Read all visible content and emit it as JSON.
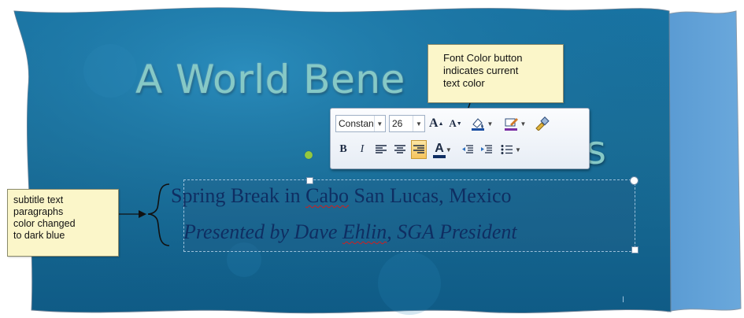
{
  "slide": {
    "title_line1": "A World Bene",
    "title_tail": "s",
    "subtitle_line1_a": "Spring Break in ",
    "subtitle_line1_b": "Cabo",
    "subtitle_line1_c": " San Lucas, Mexico",
    "subtitle_line2_a": "Presented by Dave ",
    "subtitle_line2_b": "Ehlin",
    "subtitle_line2_c": ", SGA President",
    "title_color": "#86c9c6",
    "subtitle_color": "#0f2e62",
    "background_color": "#1e6f9c"
  },
  "mini_toolbar": {
    "font_name": "Constan",
    "font_size": "26",
    "grow_font": "A",
    "shrink_font": "A",
    "bold": "B",
    "italic": "I",
    "font_color_letter": "A",
    "font_color_value": "#0f2e62",
    "icons": [
      "grow-font-icon",
      "shrink-font-icon",
      "highlight-fill-icon",
      "shape-outline-icon",
      "format-painter-icon",
      "align-left-icon",
      "center-icon",
      "align-right-icon",
      "decrease-indent-icon",
      "increase-indent-icon",
      "bullets-icon"
    ]
  },
  "callouts": {
    "font_color": [
      "Font Color button",
      "indicates current",
      "text color"
    ],
    "subtitle": [
      "subtitle text",
      "paragraphs",
      "color changed",
      "to dark blue"
    ]
  }
}
